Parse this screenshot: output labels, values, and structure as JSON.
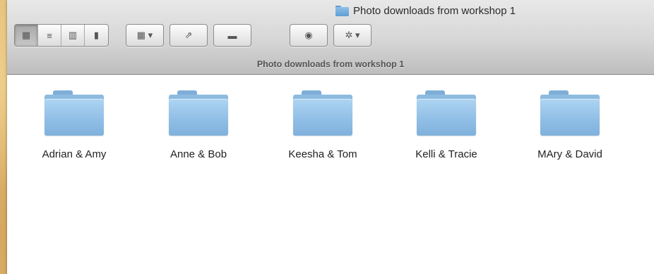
{
  "window": {
    "title": "Photo downloads from workshop 1",
    "status_title": "Photo downloads from workshop 1"
  },
  "toolbar": {
    "view_buttons": [
      {
        "name": "icon-view",
        "icon": "grid-icon",
        "glyph": "▦",
        "active": true
      },
      {
        "name": "list-view",
        "icon": "list-icon",
        "glyph": "≡",
        "active": false
      },
      {
        "name": "column-view",
        "icon": "columns-icon",
        "glyph": "▥",
        "active": false
      },
      {
        "name": "coverflow-view",
        "icon": "coverflow-icon",
        "glyph": "▮",
        "active": false
      }
    ],
    "arrange_glyph": "▦ ▾",
    "share_glyph": "⇗",
    "tag_glyph": "▬",
    "quicklook_glyph": "◉",
    "action_glyph": "✲ ▾"
  },
  "folders": [
    {
      "name": "Adrian & Amy"
    },
    {
      "name": "Anne & Bob"
    },
    {
      "name": "Keesha & Tom"
    },
    {
      "name": "Kelli & Tracie"
    },
    {
      "name": "MAry & David"
    }
  ]
}
